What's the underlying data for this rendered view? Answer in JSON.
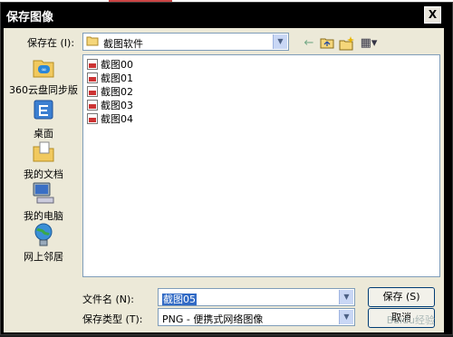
{
  "window": {
    "title": "保存图像",
    "close_glyph": "X"
  },
  "savein": {
    "label": "保存在 (I):",
    "value": "截图软件",
    "toolbar": {
      "back_glyph": "←",
      "up_glyph": "⬑",
      "newfolder_glyph": "✶",
      "views_glyph": "▦▾"
    }
  },
  "places": [
    {
      "label": "360云盘同步版",
      "icon": "cloud-sync-icon"
    },
    {
      "label": "桌面",
      "icon": "desktop-icon"
    },
    {
      "label": "我的文档",
      "icon": "my-documents-icon"
    },
    {
      "label": "我的电脑",
      "icon": "my-computer-icon"
    },
    {
      "label": "网上邻居",
      "icon": "network-icon"
    }
  ],
  "files": [
    "截图00",
    "截图01",
    "截图02",
    "截图03",
    "截图04"
  ],
  "filename": {
    "label": "文件名 (N):",
    "value": "截图05"
  },
  "filetype": {
    "label": "保存类型 (T):",
    "value": "PNG - 便携式网络图像"
  },
  "buttons": {
    "save": "保存 (S)",
    "cancel": "取消"
  },
  "watermark": "Baidu经验",
  "colors": {
    "selection": "#316ac5",
    "dialog_bg": "#ece9d8",
    "titlebar": "#000000"
  }
}
